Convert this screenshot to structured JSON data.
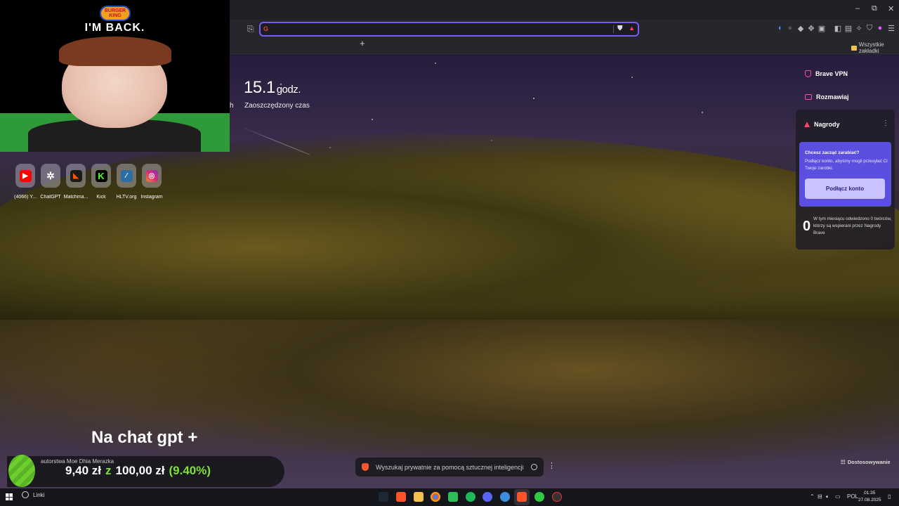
{
  "webcam": {
    "overlay_title": "I'M BACK.",
    "badge_text": "BURGER KING"
  },
  "browser": {
    "window_controls": {
      "minimize": "–",
      "maximize": "⧉",
      "close": "✕"
    },
    "urlbar": {
      "value": "",
      "placeholder": ""
    },
    "bookmarks_bar": {
      "all_bookmarks": "Wszystkie zakładki"
    }
  },
  "stats": {
    "time_saved_value": "15.1",
    "time_saved_unit": "godz.",
    "time_saved_label": "Zaoszczędzony czas",
    "truncated_prefix": "h"
  },
  "top_sites": [
    {
      "label": "(4066) Y...",
      "icon": "youtube-icon",
      "color": "#ff0000"
    },
    {
      "label": "ChatGPT",
      "icon": "chatgpt-icon",
      "color": "#ffffff"
    },
    {
      "label": "Matchma...",
      "icon": "faceit-icon",
      "color": "#ff5500"
    },
    {
      "label": "Kick",
      "icon": "kick-icon",
      "color": "#53fc18"
    },
    {
      "label": "HLTV.org",
      "icon": "hltv-icon",
      "color": "#2d6da3"
    },
    {
      "label": "Instagram",
      "icon": "instagram-icon",
      "color": "#d6249f"
    }
  ],
  "right_panel": {
    "vpn": "Brave VPN",
    "chat": "Rozmawiaj",
    "rewards": {
      "title": "Nagrody",
      "prompt_title": "Chcesz zacząć zarabiać?",
      "prompt_text": "Podłącz konto, abyśmy mogli przesyłać Ci Twoje zarobki.",
      "connect_button": "Podłącz konto",
      "creators_count": "0",
      "creators_text": "W tym miesiącu odwiedzono 0 twórców, którzy są wspierani przez Nagrody Brave"
    }
  },
  "overlay": {
    "stream_text": "Na chat gpt +",
    "donation_author": "autorstwa Moe Dhia Merazka",
    "donation_current": "9,40 zł",
    "donation_sep": "z",
    "donation_goal": "100,00 zł",
    "donation_percent": "(9.40%)"
  },
  "ai_search": {
    "placeholder": "Wyszukaj prywatnie za pomocą sztucznej inteligencji"
  },
  "customize_label": "Dostosowywanie",
  "taskbar": {
    "search_label": "Linki",
    "language": "POL",
    "time": "01:35",
    "date": "27.08.2025"
  },
  "colors": {
    "accent": "#7b5cf0",
    "rewards_box": "#5b4fe0",
    "donation_green": "#7ee03a"
  }
}
